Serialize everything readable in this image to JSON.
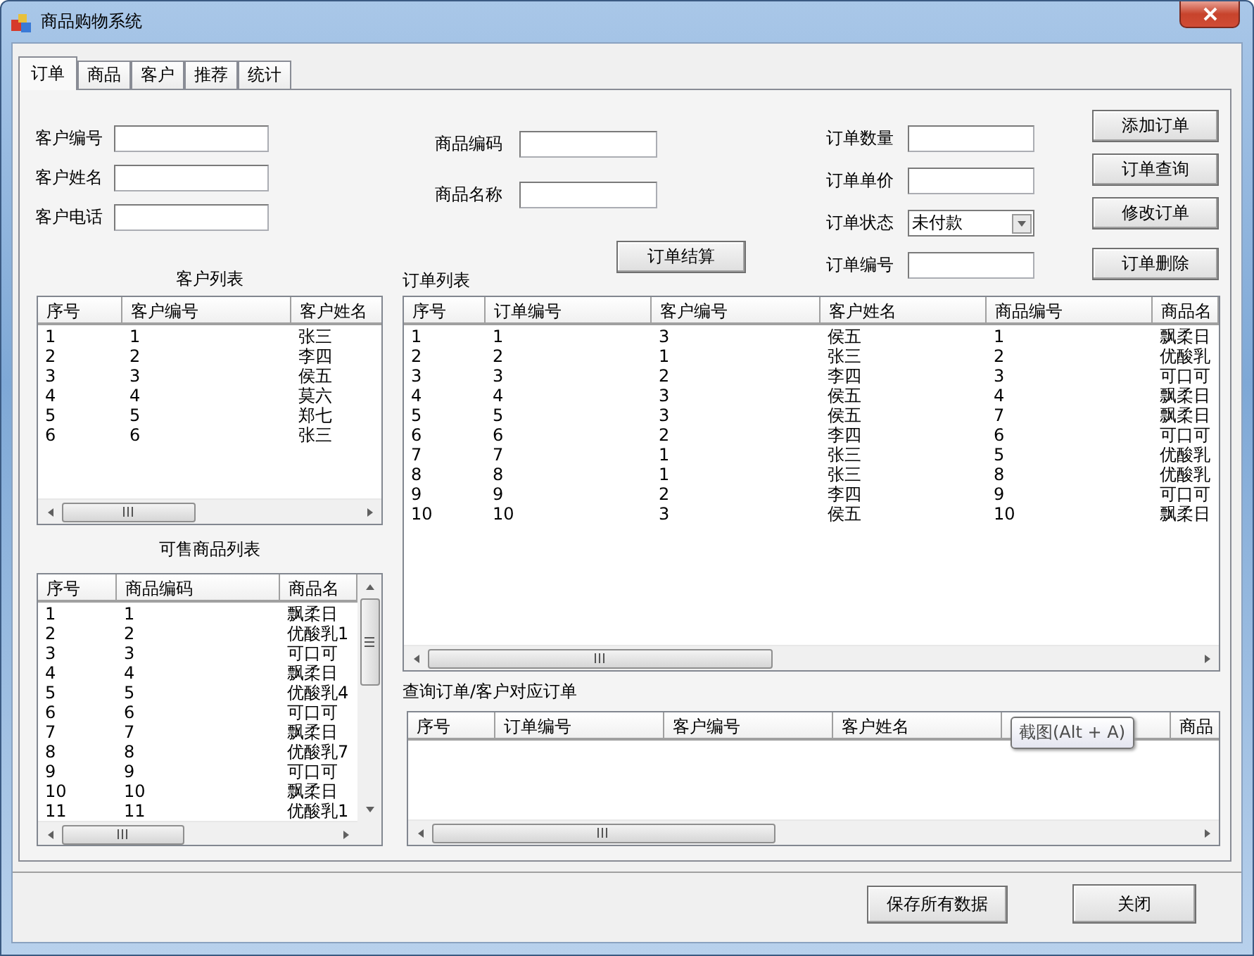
{
  "window": {
    "title": "商品购物系统"
  },
  "tabs": [
    {
      "label": "订单",
      "selected": true
    },
    {
      "label": "商品",
      "selected": false
    },
    {
      "label": "客户",
      "selected": false
    },
    {
      "label": "推荐",
      "selected": false
    },
    {
      "label": "统计",
      "selected": false
    }
  ],
  "customer_form": [
    {
      "label": "客户编号"
    },
    {
      "label": "客户姓名"
    },
    {
      "label": "客户电话"
    }
  ],
  "product_form": [
    {
      "label": "商品编码"
    },
    {
      "label": "商品名称"
    }
  ],
  "checkout_button": "订单结算",
  "order_form": [
    {
      "label": "订单数量",
      "kind": "text"
    },
    {
      "label": "订单单价",
      "kind": "text"
    },
    {
      "label": "订单状态",
      "kind": "combo",
      "value": "未付款"
    },
    {
      "label": "订单编号",
      "kind": "text"
    }
  ],
  "action_buttons": [
    "添加订单",
    "订单查询",
    "修改订单",
    "订单删除"
  ],
  "customer_list": {
    "title": "客户列表",
    "columns": [
      {
        "label": "序号"
      },
      {
        "label": "客户编号"
      },
      {
        "label": "客户姓名"
      }
    ],
    "rows": [
      [
        "1",
        "1",
        "张三"
      ],
      [
        "2",
        "2",
        "李四"
      ],
      [
        "3",
        "3",
        "侯五"
      ],
      [
        "4",
        "4",
        "莫六"
      ],
      [
        "5",
        "5",
        "郑七"
      ],
      [
        "6",
        "6",
        "张三"
      ]
    ]
  },
  "product_list": {
    "title": "可售商品列表",
    "columns": [
      {
        "label": "序号"
      },
      {
        "label": "商品编码"
      },
      {
        "label": "商品名"
      }
    ],
    "rows": [
      [
        "1",
        "1",
        "飘柔日"
      ],
      [
        "2",
        "2",
        "优酸乳1"
      ],
      [
        "3",
        "3",
        "可口可"
      ],
      [
        "4",
        "4",
        "飘柔日"
      ],
      [
        "5",
        "5",
        "优酸乳4"
      ],
      [
        "6",
        "6",
        "可口可"
      ],
      [
        "7",
        "7",
        "飘柔日"
      ],
      [
        "8",
        "8",
        "优酸乳7"
      ],
      [
        "9",
        "9",
        "可口可"
      ],
      [
        "10",
        "10",
        "飘柔日"
      ],
      [
        "11",
        "11",
        "优酸乳1"
      ]
    ]
  },
  "order_list": {
    "title": "订单列表",
    "columns": [
      {
        "label": "序号"
      },
      {
        "label": "订单编号"
      },
      {
        "label": "客户编号"
      },
      {
        "label": "客户姓名"
      },
      {
        "label": "商品编号"
      },
      {
        "label": "商品名"
      }
    ],
    "rows": [
      [
        "1",
        "1",
        "3",
        "侯五",
        "1",
        "飘柔日"
      ],
      [
        "2",
        "2",
        "1",
        "张三",
        "2",
        "优酸乳"
      ],
      [
        "3",
        "3",
        "2",
        "李四",
        "3",
        "可口可"
      ],
      [
        "4",
        "4",
        "3",
        "侯五",
        "4",
        "飘柔日"
      ],
      [
        "5",
        "5",
        "3",
        "侯五",
        "7",
        "飘柔日"
      ],
      [
        "6",
        "6",
        "2",
        "李四",
        "6",
        "可口可"
      ],
      [
        "7",
        "7",
        "1",
        "张三",
        "5",
        "优酸乳"
      ],
      [
        "8",
        "8",
        "1",
        "张三",
        "8",
        "优酸乳"
      ],
      [
        "9",
        "9",
        "2",
        "李四",
        "9",
        "可口可"
      ],
      [
        "10",
        "10",
        "3",
        "侯五",
        "10",
        "飘柔日"
      ]
    ]
  },
  "query_list": {
    "title": "查询订单/客户对应订单",
    "columns": [
      {
        "label": "序号"
      },
      {
        "label": "订单编号"
      },
      {
        "label": "客户编号"
      },
      {
        "label": "客户姓名"
      },
      {},
      {
        "label": "商品"
      }
    ]
  },
  "tooltip": "截图(Alt + A)",
  "footer_buttons": [
    "保存所有数据",
    "关闭"
  ]
}
